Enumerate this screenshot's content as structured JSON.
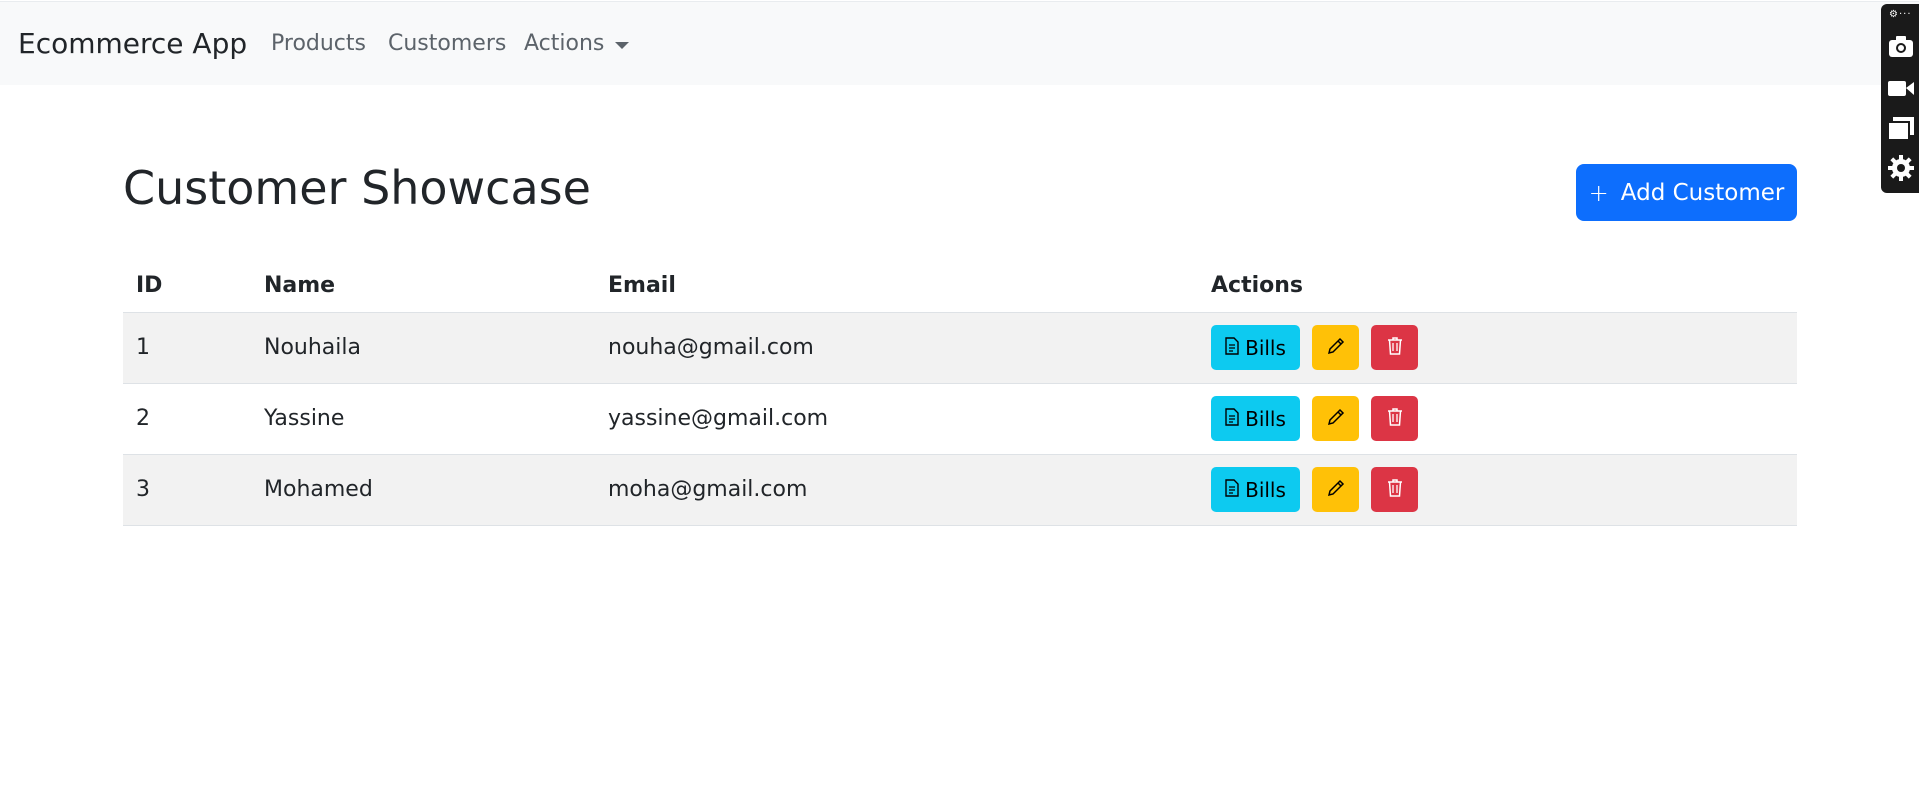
{
  "navbar": {
    "brand": "Ecommerce App",
    "links": {
      "products": "Products",
      "customers": "Customers",
      "actions": "Actions"
    }
  },
  "page": {
    "title": "Customer Showcase",
    "add_button_label": "Add Customer"
  },
  "table": {
    "headers": {
      "id": "ID",
      "name": "Name",
      "email": "Email",
      "actions": "Actions"
    },
    "rows": [
      {
        "id": "1",
        "name": "Nouhaila",
        "email": "nouha@gmail.com",
        "bills_label": "Bills"
      },
      {
        "id": "2",
        "name": "Yassine",
        "email": "yassine@gmail.com",
        "bills_label": "Bills"
      },
      {
        "id": "3",
        "name": "Mohamed",
        "email": "moha@gmail.com",
        "bills_label": "Bills"
      }
    ]
  },
  "icons": {
    "plus": "plus-icon",
    "bills": "file-text-icon",
    "edit": "pencil-icon",
    "delete": "trash-icon",
    "panel": [
      "camera-icon",
      "video-icon",
      "window-icon",
      "gear-icon"
    ]
  },
  "colors": {
    "primary": "#0d6efd",
    "info": "#0dcaf0",
    "warning": "#ffc107",
    "danger": "#dc3545",
    "navbar_bg": "#f8f9fa"
  }
}
